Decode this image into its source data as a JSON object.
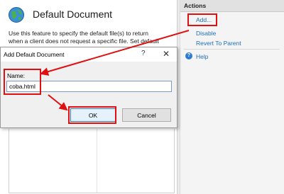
{
  "header": {
    "title": "Default Document",
    "description_line1": "Use this feature to specify the default file(s) to return",
    "description_line2": "when a client does not request a specific file. Set default"
  },
  "actions": {
    "title": "Actions",
    "items": [
      {
        "label": "Add..."
      },
      {
        "label": "Disable"
      },
      {
        "label": "Revert To Parent"
      },
      {
        "label": "Help"
      }
    ]
  },
  "dialog": {
    "title": "Add Default Document",
    "help_glyph": "?",
    "close_glyph": "✕",
    "name_label": "Name:",
    "name_value": "coba.html",
    "ok_label": "OK",
    "cancel_label": "Cancel"
  },
  "colors": {
    "highlight": "#e01010",
    "link": "#1f6fb6",
    "accent": "#2d7bd0"
  },
  "icons": {
    "header": "globe-document-icon",
    "help": "help-icon"
  }
}
